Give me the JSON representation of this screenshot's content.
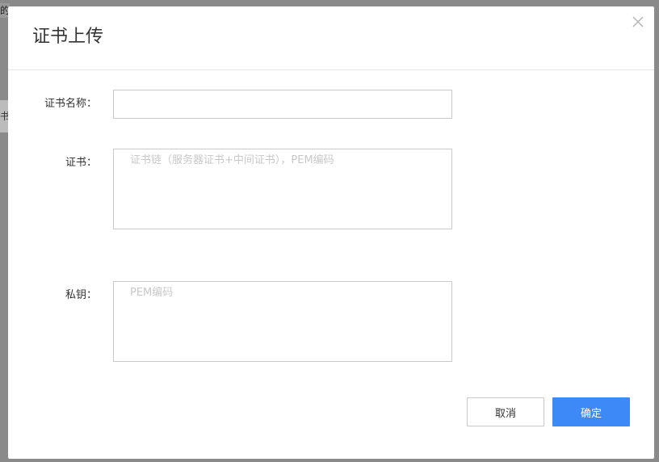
{
  "background": {
    "fragment_top": "的",
    "fragment_mid": "书"
  },
  "dialog": {
    "title": "证书上传",
    "close_icon": "close-icon",
    "fields": {
      "name": {
        "label": "证书名称：",
        "value": "",
        "placeholder": ""
      },
      "certificate": {
        "label": "证书：",
        "value": "",
        "placeholder": "证书链（服务器证书+中间证书），PEM编码"
      },
      "private_key": {
        "label": "私钥：",
        "value": "",
        "placeholder": "PEM编码"
      }
    },
    "buttons": {
      "cancel": "取消",
      "confirm": "确定"
    }
  },
  "colors": {
    "primary": "#3d8af7",
    "overlay": "#8a8a8a",
    "border": "#c9c9c9",
    "text": "#333333",
    "placeholder": "#c8c8c8"
  }
}
